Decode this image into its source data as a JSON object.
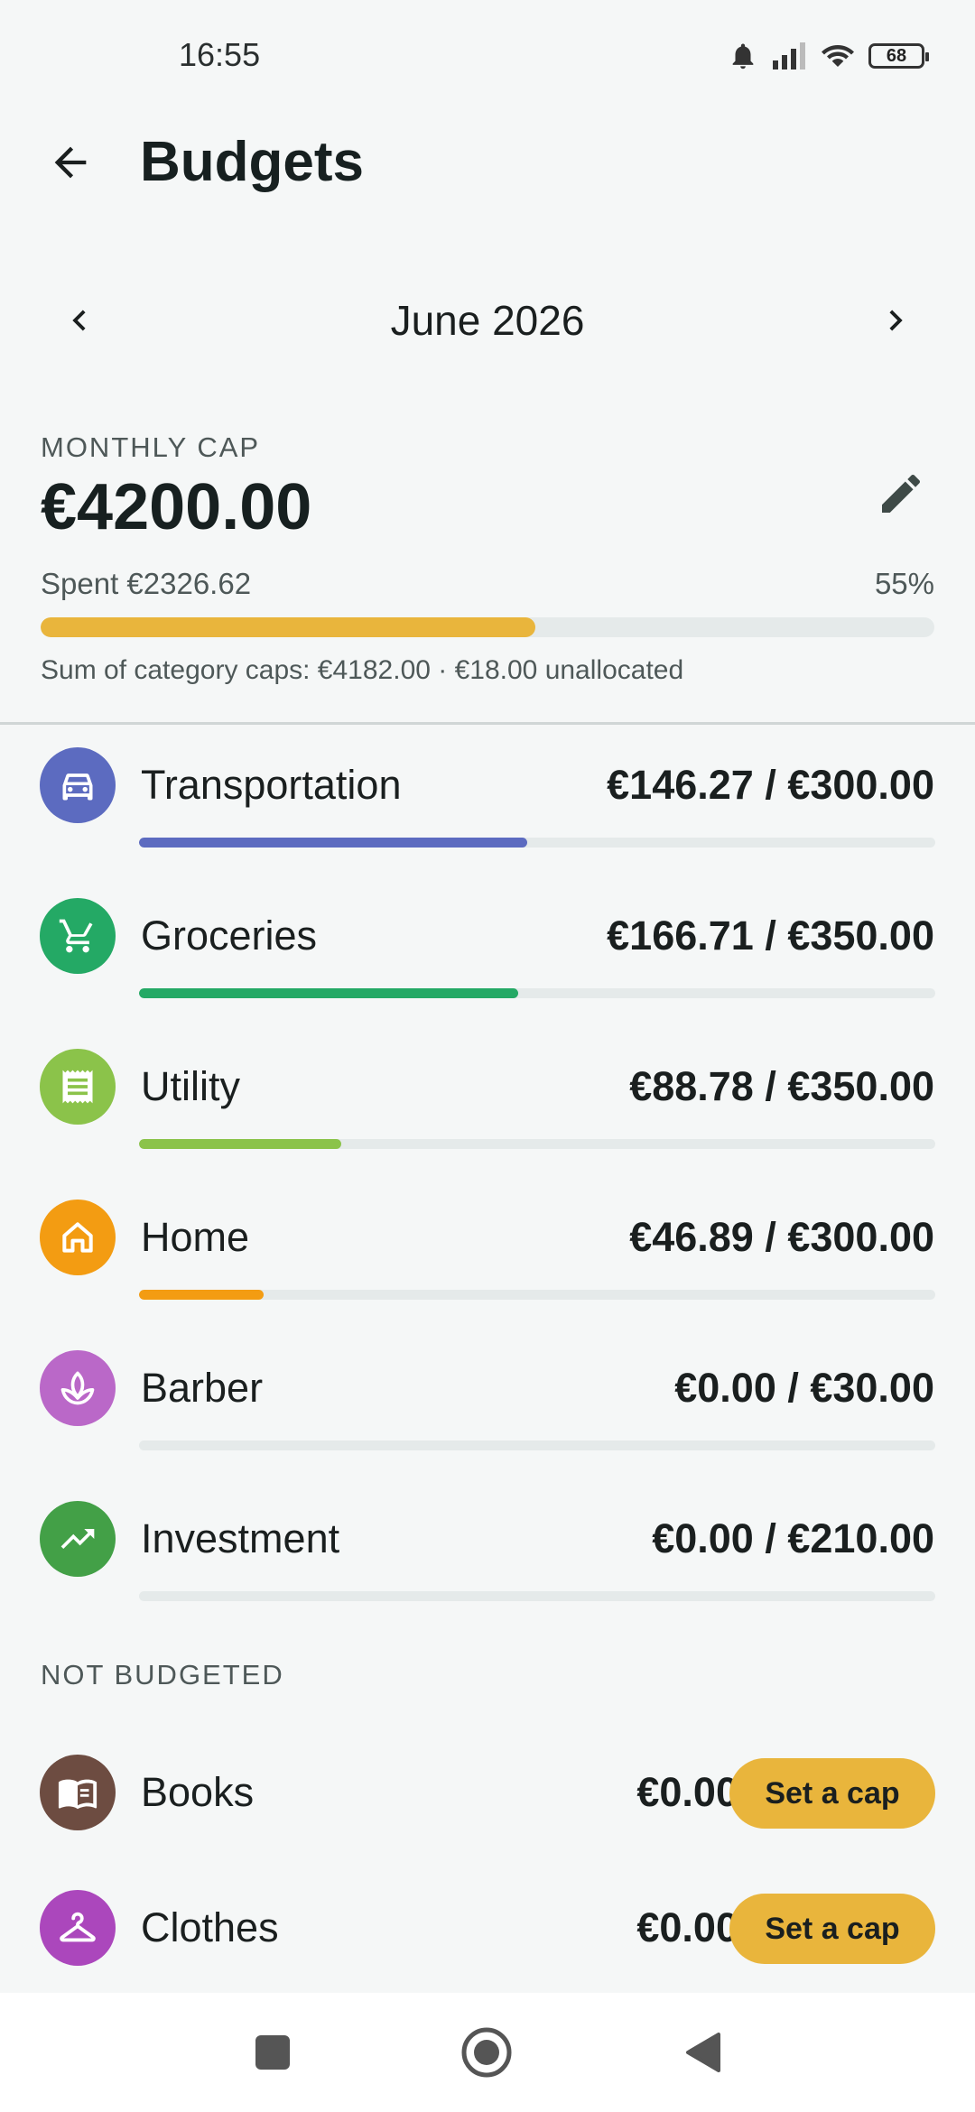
{
  "status_bar": {
    "time": "16:55",
    "battery": "68"
  },
  "app_bar": {
    "title": "Budgets"
  },
  "month_nav": {
    "label": "June 2026"
  },
  "monthly_cap": {
    "label": "MONTHLY CAP",
    "amount": "€4200.00",
    "spent": "Spent €2326.62",
    "percent": "55%",
    "progress_fraction": 0.554,
    "allocation": "Sum of category caps: €4182.00 · €18.00 unallocated",
    "bar_color": "#e9b53c"
  },
  "categories": [
    {
      "name": "Transportation",
      "amount": "€146.27 / €300.00",
      "fraction": 0.4876,
      "color": "#5c6bc0",
      "icon": "car-icon"
    },
    {
      "name": "Groceries",
      "amount": "€166.71 / €350.00",
      "fraction": 0.4763,
      "color": "#24a965",
      "icon": "cart-icon"
    },
    {
      "name": "Utility",
      "amount": "€88.78 / €350.00",
      "fraction": 0.2537,
      "color": "#8bc34a",
      "icon": "receipt-icon"
    },
    {
      "name": "Home",
      "amount": "€46.89 / €300.00",
      "fraction": 0.1563,
      "color": "#f39c12",
      "icon": "home-icon"
    },
    {
      "name": "Barber",
      "amount": "€0.00 / €30.00",
      "fraction": 0,
      "color": "#ba68c8",
      "icon": "spa-icon"
    },
    {
      "name": "Investment",
      "amount": "€0.00 / €210.00",
      "fraction": 0,
      "color": "#43a047",
      "icon": "trending-up-icon"
    }
  ],
  "not_budgeted": {
    "label": "NOT BUDGETED",
    "button_label": "Set a cap",
    "items": [
      {
        "name": "Books",
        "amount": "€0.00",
        "color": "#6d4c41",
        "icon": "book-icon"
      },
      {
        "name": "Clothes",
        "amount": "€0.00",
        "color": "#ab47bc",
        "icon": "hanger-icon"
      }
    ]
  }
}
